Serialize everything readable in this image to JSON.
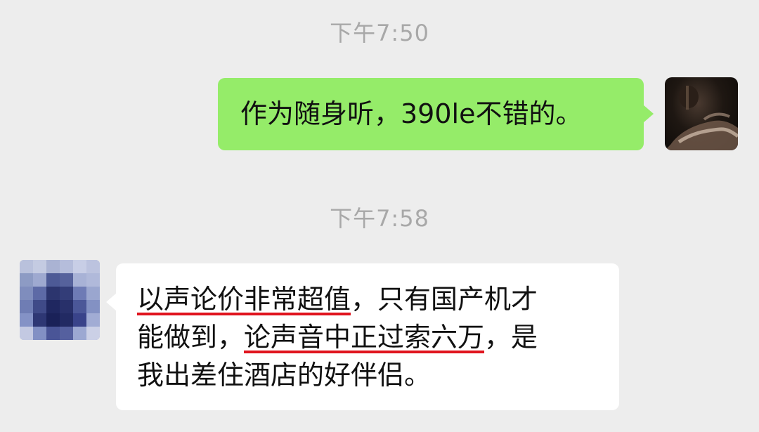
{
  "messages": [
    {
      "timestamp": "下午7:50",
      "sender": "self",
      "text": "作为随身听，390le不错的。"
    },
    {
      "timestamp": "下午7:58",
      "sender": "other",
      "segments": {
        "l1_under": "以声论价非常超值",
        "l1_rest": "，只有国产机才",
        "l2_pre": "能做到，",
        "l2_under": "论声音中正过索六万",
        "l2_rest": "，是",
        "l3": "我出差住酒店的好伴侣。"
      }
    }
  ],
  "colors": {
    "background": "#ededed",
    "self_bubble": "#95ec69",
    "other_bubble": "#ffffff",
    "timestamp": "#a8a8a8",
    "underline": "#e0141e"
  }
}
